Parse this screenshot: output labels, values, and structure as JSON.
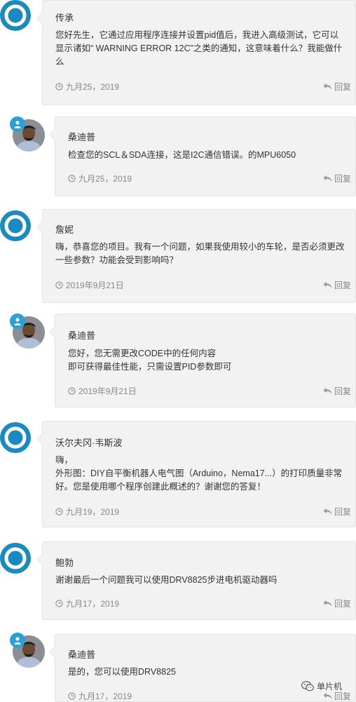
{
  "comments": [
    {
      "author": "传承",
      "lines": [
        "您好先生，它通过应用程序连接并设置pid值后，我进入高级测试，它可以",
        "显示诸如“ WARNING ERROR 12C”之类的通知，这意味着什么？我能做什",
        "么"
      ],
      "date": "九月25，2019",
      "reply": "回复"
    },
    {
      "author": "桑迪普",
      "lines": [
        "检查您的SCL＆SDA连接，这是I2C通信错误。的MPU6050"
      ],
      "date": "九月25，2019",
      "reply": "回复"
    },
    {
      "author": "詹妮",
      "lines": [
        "嗨，恭喜您的项目。我有一个问题，如果我使用较小的车轮，是否必须更改",
        "一些参数？功能会受到影响吗？"
      ],
      "date": "2019年9月21日",
      "reply": "回复"
    },
    {
      "author": "桑迪普",
      "lines": [
        "您好，您无需更改CODE中的任何内容",
        "即可获得最佳性能，只需设置PID参数即可"
      ],
      "date": "2019年9月21日",
      "reply": "回复"
    },
    {
      "author": "沃尔夫冈·韦斯波",
      "lines": [
        "嗨，",
        "外形图：DIY自平衡机器人电气图（Arduino，Nema17...）的打印质量非常",
        "好。您是使用哪个程序创建此概述的？谢谢您的答复！"
      ],
      "date": "九月19，2019",
      "reply": "回复"
    },
    {
      "author": "鲍勃",
      "lines": [
        "谢谢最后一个问题我可以使用DRV8825步进电机驱动器吗"
      ],
      "date": "九月17，2019",
      "reply": "回复"
    },
    {
      "author": "桑迪普",
      "lines": [
        "是的，您可以使用DRV8825"
      ],
      "date": "九月17，2019",
      "reply": "回复"
    }
  ],
  "watermark": {
    "label": "单片机"
  },
  "colors": {
    "bubble_bg": "#f2f2f2",
    "avatar_blue": "#1a8bc1",
    "badge_blue": "#2aa0d8",
    "text": "#333333",
    "muted": "#888888"
  },
  "icons": {
    "default_avatar": "wordpress-logo-icon",
    "user_badge": "user-icon",
    "date": "clock-icon",
    "reply": "reply-arrow-icon",
    "watermark": "wechat-icon"
  }
}
